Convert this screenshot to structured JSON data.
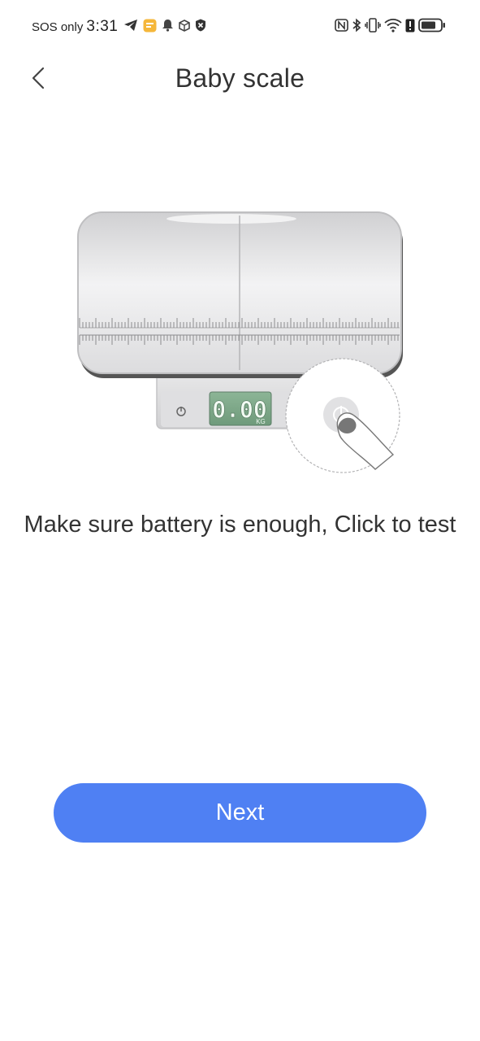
{
  "status_bar": {
    "carrier": "SOS only",
    "time": "3:31",
    "icons_left": [
      "telegram-icon",
      "notes-app-icon",
      "bell-icon",
      "cube-icon",
      "shield-icon"
    ],
    "icons_right": [
      "nfc-icon",
      "bluetooth-icon",
      "vibrate-icon",
      "wifi-icon",
      "alert-icon",
      "battery-icon"
    ]
  },
  "header": {
    "back_icon": "chevron-left-icon",
    "title": "Baby scale"
  },
  "illustration": {
    "display_value": "0.00",
    "display_unit": "KG"
  },
  "instruction": {
    "text": "Make sure battery is enough, Click to test"
  },
  "actions": {
    "next_label": "Next"
  },
  "colors": {
    "primary": "#4f80f3",
    "text": "#333333",
    "display_bg": "#7fa789"
  }
}
